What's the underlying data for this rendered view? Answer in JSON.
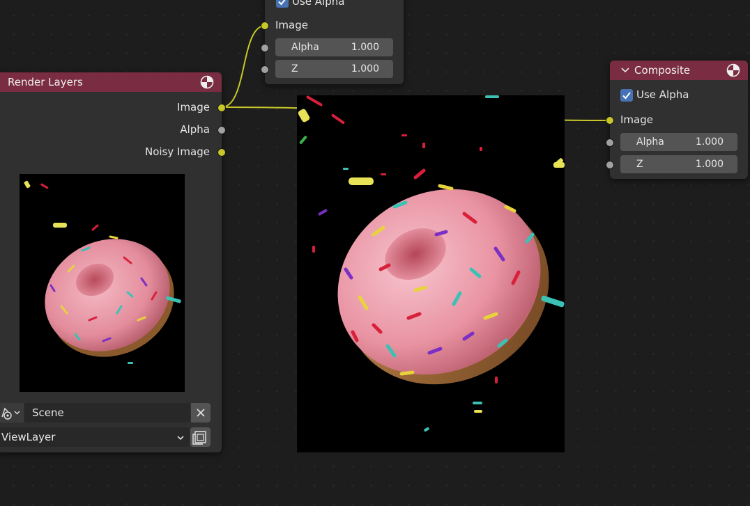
{
  "top_node": {
    "use_alpha_label": "Use Alpha",
    "use_alpha_checked": true,
    "inputs": {
      "image_label": "Image",
      "alpha_label": "Alpha",
      "alpha_value": "1.000",
      "z_label": "Z",
      "z_value": "1.000"
    }
  },
  "render_layers": {
    "title": "Render Layers",
    "outputs": {
      "image": "Image",
      "alpha": "Alpha",
      "noisy_image": "Noisy Image"
    },
    "scene_field": "Scene",
    "view_layer_field": "ViewLayer"
  },
  "composite": {
    "title": "Composite",
    "use_alpha_label": "Use Alpha",
    "use_alpha_checked": true,
    "inputs": {
      "image_label": "Image",
      "alpha_label": "Alpha",
      "alpha_value": "1.000",
      "z_label": "Z",
      "z_value": "1.000"
    }
  },
  "colors": {
    "header_red": "#7a2c43",
    "node_body": "#303030",
    "socket_image": "#c7c729",
    "socket_value": "#a1a1a1",
    "checkbox_blue": "#4772b3",
    "wire": "#c7c729"
  },
  "icons": {
    "render_header": "render-result-icon",
    "composite_header": "render-result-icon",
    "scene": "scene-data-icon",
    "clear": "close-icon",
    "view_layer": "render-layers-icon"
  }
}
